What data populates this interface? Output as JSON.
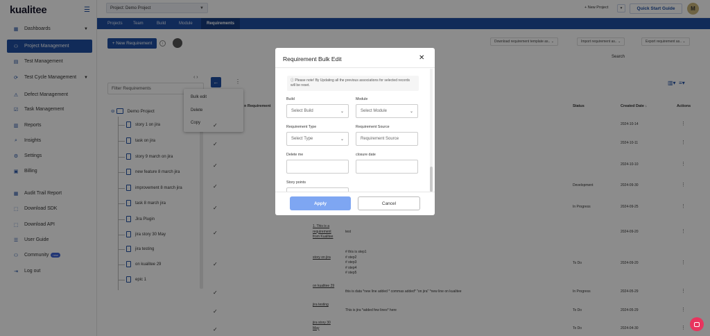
{
  "brand": {
    "logo_text": "kualitee"
  },
  "header": {
    "project_label": "Project:",
    "project_value": "Demo Project",
    "new_project": "+ New Project",
    "quick_start": "Quick Start Guide",
    "avatar_initial": "M"
  },
  "sidebar": {
    "items": [
      {
        "label": "Dashboards",
        "icon": "dashboard-icon",
        "caret": true
      },
      {
        "label": "Project Management",
        "icon": "project-icon",
        "active": true
      },
      {
        "label": "Test Management",
        "icon": "test-icon"
      },
      {
        "label": "Test Cycle Management",
        "icon": "cycle-icon",
        "caret": true
      },
      {
        "label": "Defect Management",
        "icon": "defect-icon"
      },
      {
        "label": "Task Management",
        "icon": "task-icon"
      },
      {
        "label": "Reports",
        "icon": "reports-icon"
      },
      {
        "label": "Insights",
        "icon": "insights-icon"
      },
      {
        "label": "Settings",
        "icon": "settings-icon"
      },
      {
        "label": "Billing",
        "icon": "billing-icon"
      },
      {
        "label": "Audit Trail Report",
        "icon": "audit-icon"
      },
      {
        "label": "Download SDK",
        "icon": "sdk-icon"
      },
      {
        "label": "Download API",
        "icon": "api-icon"
      },
      {
        "label": "User Guide",
        "icon": "guide-icon"
      },
      {
        "label": "Community",
        "icon": "community-icon",
        "badge": "new"
      },
      {
        "label": "Log out",
        "icon": "logout-icon"
      }
    ]
  },
  "tabs": [
    "Projects",
    "Team",
    "Build",
    "Module",
    "Requirements"
  ],
  "toolbar": {
    "new_requirement": "+ New Requirement",
    "download_template": "Download requirement template as..",
    "import": "Import requirement as..",
    "export": "Export requirement as..",
    "search": "Search"
  },
  "tree": {
    "filter_placeholder": "Filter Requirements",
    "root": "Demo Project",
    "items": [
      "story 1 on jira",
      "task on jira",
      "story 9 march on jira",
      "new feature 8 march jira",
      "improvement 8 march jira",
      "task 8 march jira",
      "Jira Plugin",
      "jira story 30 May",
      "jira testing",
      "on kualitee 29",
      "epic 1"
    ]
  },
  "context_menu": [
    "Bulk edit",
    "Delete",
    "Copy"
  ],
  "table": {
    "headers": {
      "requirement": "n Requirement",
      "status": "Status",
      "created": "Created Date",
      "actions": "Actions"
    },
    "rows": [
      {
        "status": "",
        "date": "2024-10-14"
      },
      {
        "status": "",
        "date": "2024-10-11"
      },
      {
        "status": "",
        "date": "2024-10-10"
      },
      {
        "status": "Development",
        "date": "2024-09-30"
      },
      {
        "status": "In Progress",
        "date": "2024-09-25"
      },
      {
        "name": "1. This is a requirement from Kualitee",
        "desc": "test",
        "status": "",
        "date": "2024-09-20"
      },
      {
        "name": "story on jira",
        "desc": "# this is step1\n# step2\n# step3\n# step4\n# step5",
        "status": "To Do",
        "date": "2024-09-20"
      },
      {
        "name": "on kualitee 29",
        "desc": "this is data *new line added * commas added* \"on jira\" *new line on kualitee",
        "status": "In Progress",
        "date": "2024-05-29"
      },
      {
        "name": "jira testing",
        "desc": "This is jira *added few lines* here",
        "status": "To Do",
        "date": "2024-05-29"
      },
      {
        "name": "jira story 30 May",
        "desc": "",
        "status": "To Do",
        "date": "2024-04-30"
      }
    ]
  },
  "modal": {
    "title": "Requirement Bulk Edit",
    "note": "Please note! By Updating all the previous associations for selected records will be reset.",
    "build_label": "Build",
    "build_placeholder": "Select Build",
    "module_label": "Module",
    "module_placeholder": "Select Module",
    "type_label": "Requirement Type",
    "type_placeholder": "Select Type",
    "source_label": "Requirement Source",
    "source_placeholder": "Requirement Source",
    "delete_label": "Delete me",
    "closure_label": "closure date",
    "story_label": "Story points",
    "apply": "Apply",
    "cancel": "Cancel"
  }
}
